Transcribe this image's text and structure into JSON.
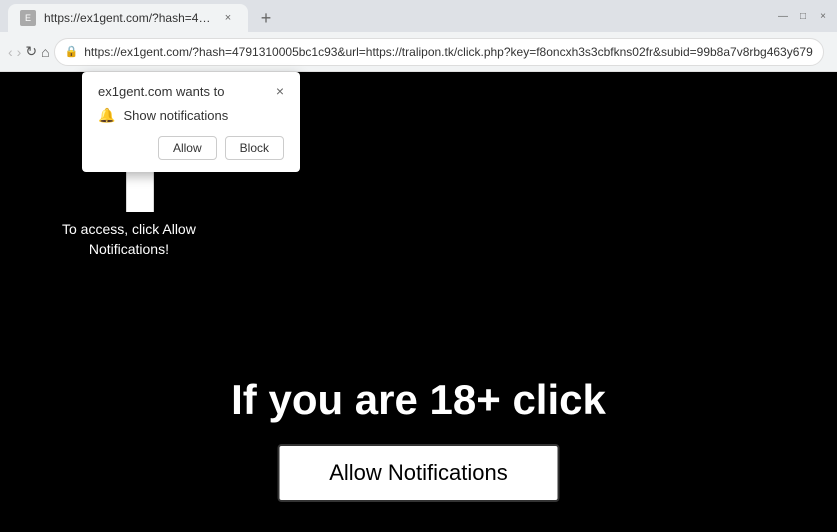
{
  "browser": {
    "tab": {
      "title": "https://ex1gent.com/?hash=47...",
      "favicon_label": "E"
    },
    "address": "https://ex1gent.com/?hash=4791310005bc1c93&url=https://tralipon.tk/click.php?key=f8oncxh3s3cbfkns02fr&subid=99b8a7v8rbg463y679",
    "new_tab_label": "+",
    "window_controls": {
      "minimize": "—",
      "maximize": "□",
      "close": "×"
    },
    "nav": {
      "back": "‹",
      "forward": "›",
      "refresh": "↻",
      "home": "⌂"
    }
  },
  "popup": {
    "title": "ex1gent.com wants to",
    "close": "×",
    "message": "Show notifications",
    "allow_label": "Allow",
    "block_label": "Block"
  },
  "page": {
    "access_text": "To access, click Allow\nNotifications!",
    "big_text": "If you are 18+ click",
    "allow_button": "Allow Notifications"
  }
}
